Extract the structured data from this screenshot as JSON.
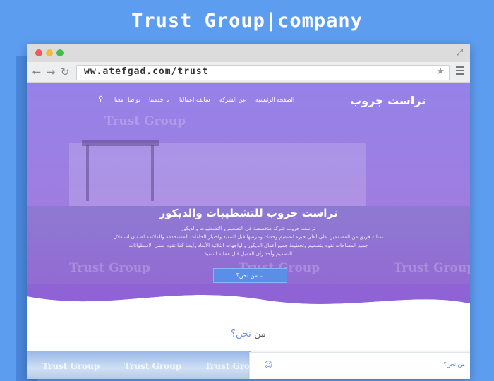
{
  "headline": "Trust Group|company",
  "browser": {
    "url": "ww.atefgad.com/trust",
    "back_icon": "←",
    "forward_icon": "→",
    "reload_icon": "↻",
    "star_icon": "★",
    "expand_icon": "⤢"
  },
  "site": {
    "brand": "تراست جروب",
    "nav": {
      "home": "الصفحة الرئيسية",
      "about": "عن الشركة",
      "works": "سابقة اعمالنا",
      "services": "خدمتنا ⌄",
      "contact": "تواصل معنا",
      "search_icon": "⚲"
    },
    "watermark": "Trust Group",
    "hero": {
      "title": "تراست جروب للتشطيبات والديكور",
      "line1": "تراست جروب شركة متخصصة فى التصميم و التشطيبات والديكور",
      "line2": "تمتلك فريق من المصممين على أعلى خبرة لتصميم وحدتك وعرضها قبل التنفيذ واختيار الخامات المستخدمة والملائمة لضمان استغلال",
      "line3": "جميع المساحات نقوم بتصميم وتخطيط جميع أعمال الديكور والواجهات الثلاثية الأبعاد وأيضا كما نقوم بعمل الاسطوانات",
      "line4": "التصميم وأخذ رأى العميل قبل عملية التنفيذ",
      "cta": "من نحن؟ ⌄"
    },
    "about": {
      "title_main": "من ",
      "title_accent": "نحن؟"
    },
    "chat": {
      "label": "من نحن؟",
      "icon": "☺"
    }
  }
}
